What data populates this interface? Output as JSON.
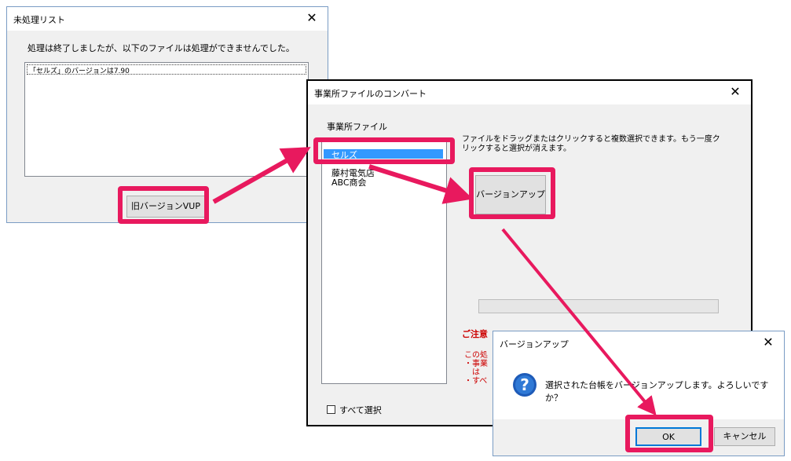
{
  "win1": {
    "title": "未処理リスト",
    "message": "処理は終了しましたが、以下のファイルは処理ができませんでした。",
    "list_item": "「セルズ」のバージョンは7.90",
    "button_label": "旧バージョンVUP"
  },
  "win2": {
    "title": "事業所ファイルのコンバート",
    "list_label": "事業所ファイル",
    "items": [
      "セルズ",
      "藤村電気店",
      "ABC商会"
    ],
    "instruction": "ファイルをドラッグまたはクリックすると複数選択できます。もう一度クリックすると選択が消えます。",
    "upgrade_button": "バージョンアップ",
    "caution_title": "ご注意",
    "caution_lines": [
      "この処",
      "・事業",
      "　は",
      "・すべ"
    ],
    "select_all_label": "すべて選択"
  },
  "win3": {
    "title": "バージョンアップ",
    "message": "選択された台帳をバージョンアップします。よろしいですか？",
    "ok_label": "OK",
    "cancel_label": "キャンセル"
  },
  "colors": {
    "accent": "#e8195e",
    "selection": "#3399ff",
    "caution": "#cc0000"
  }
}
